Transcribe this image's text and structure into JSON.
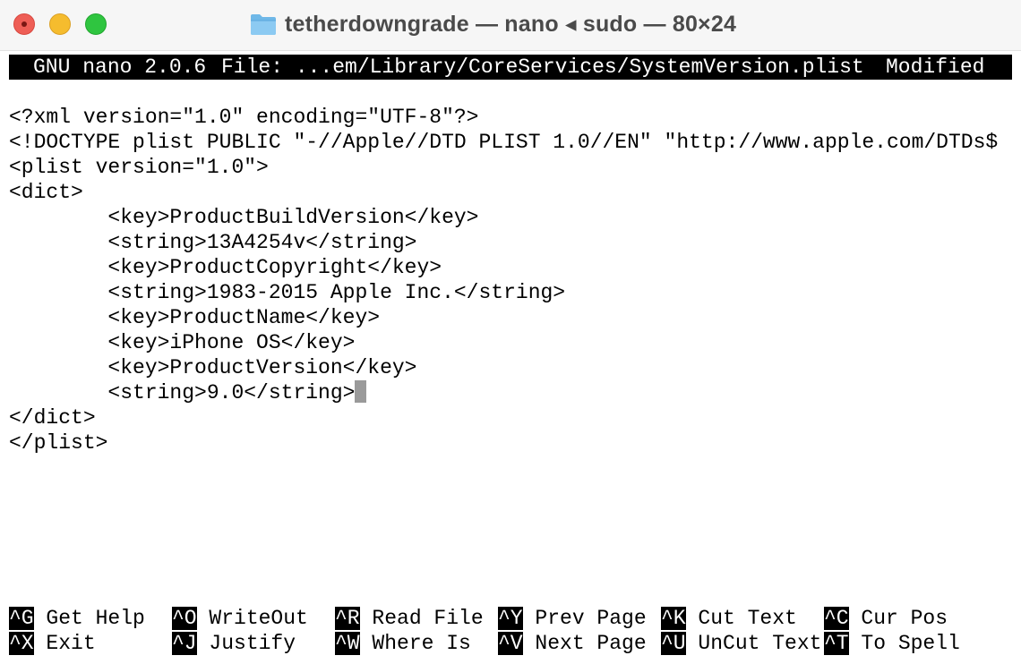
{
  "window": {
    "title": "tetherdowngrade — nano ◂ sudo — 80×24"
  },
  "nano_header": {
    "app": "GNU nano 2.0.6",
    "file": "File: ...em/Library/CoreServices/SystemVersion.plist",
    "status": "Modified"
  },
  "editor": {
    "lines": [
      "<?xml version=\"1.0\" encoding=\"UTF-8\"?>",
      "<!DOCTYPE plist PUBLIC \"-//Apple//DTD PLIST 1.0//EN\" \"http://www.apple.com/DTDs$",
      "<plist version=\"1.0\">",
      "<dict>",
      "        <key>ProductBuildVersion</key>",
      "        <string>13A4254v</string>",
      "        <key>ProductCopyright</key>",
      "        <string>1983-2015 Apple Inc.</string>",
      "        <key>ProductName</key>",
      "        <key>iPhone OS</key>",
      "        <key>ProductVersion</key>",
      "        <string>9.0</string>",
      "</dict>",
      "</plist>"
    ]
  },
  "shortcuts": [
    {
      "key": "^G",
      "label": "Get Help"
    },
    {
      "key": "^O",
      "label": "WriteOut"
    },
    {
      "key": "^R",
      "label": "Read File"
    },
    {
      "key": "^Y",
      "label": "Prev Page"
    },
    {
      "key": "^K",
      "label": "Cut Text"
    },
    {
      "key": "^C",
      "label": "Cur Pos"
    },
    {
      "key": "^X",
      "label": "Exit"
    },
    {
      "key": "^J",
      "label": "Justify"
    },
    {
      "key": "^W",
      "label": "Where Is"
    },
    {
      "key": "^V",
      "label": "Next Page"
    },
    {
      "key": "^U",
      "label": "UnCut Text"
    },
    {
      "key": "^T",
      "label": "To Spell"
    }
  ],
  "colors": {
    "close": "#ee5e56",
    "minimize": "#f5bc2e",
    "maximize": "#2fc540",
    "cursor": "#9a9a9a"
  },
  "icons": {
    "folder": "folder-icon"
  }
}
